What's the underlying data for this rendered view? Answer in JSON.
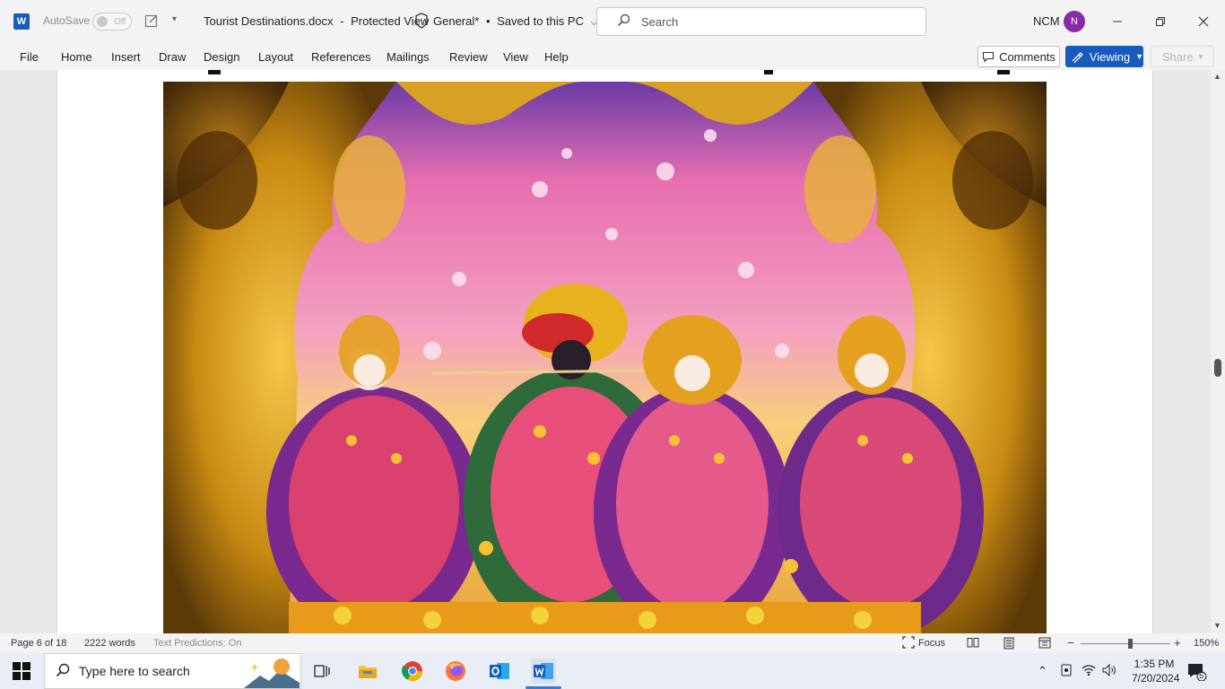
{
  "titlebar": {
    "autosave_label": "AutoSave",
    "autosave_state": "Off",
    "document_name": "Tourist Destinations.docx",
    "separator": "-",
    "view_mode": "Protected View",
    "sensitivity": "General*",
    "bullet": "•",
    "save_status": "Saved to this PC",
    "search_placeholder": "Search",
    "user_initials": "NCM",
    "avatar_letter": "N"
  },
  "menu": {
    "items": [
      "File",
      "Home",
      "Insert",
      "Draw",
      "Design",
      "Layout",
      "References",
      "Mailings",
      "Review",
      "View",
      "Help"
    ],
    "comments_label": "Comments",
    "viewing_label": "Viewing",
    "share_label": "Share"
  },
  "statusbar": {
    "page": "Page 6 of 18",
    "words": "2222 words",
    "predictions": "Text Predictions: On",
    "focus": "Focus",
    "zoom": "150%",
    "zoom_minus": "−",
    "zoom_plus": "+"
  },
  "taskbar": {
    "search_placeholder": "Type here to search",
    "time": "1:35 PM",
    "date": "7/20/2024",
    "notification_count": "5"
  },
  "colors": {
    "word_blue": "#185abd",
    "avatar_purple": "#8a2aa6",
    "page_bg": "#ffffff",
    "chrome_bg": "#f3f3f3"
  }
}
